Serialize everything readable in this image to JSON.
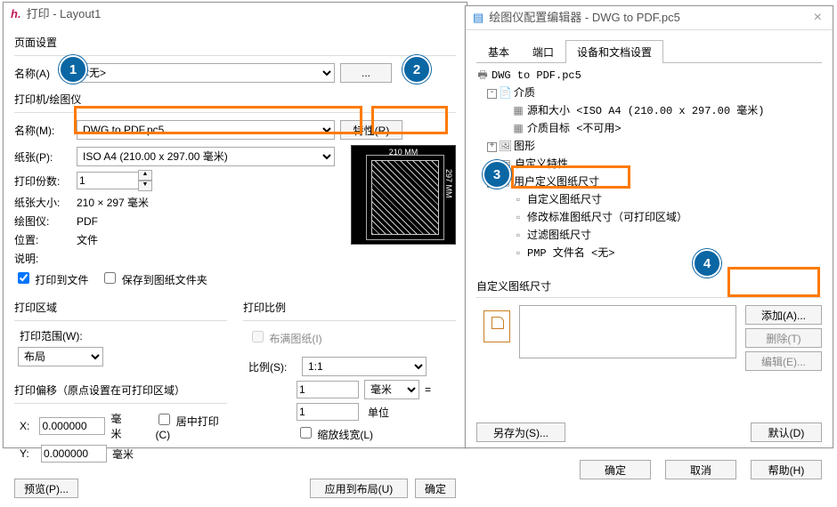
{
  "print": {
    "title_prefix": "打印",
    "title_doc": "Layout1",
    "page_setup": "页面设置",
    "name_a": "名称(A)",
    "name_a_value": "<无>",
    "name_a_btn": "...",
    "printer_group": "打印机/绘图仪",
    "name_m": "名称(M):",
    "name_m_value": "DWG to PDF.pc5",
    "props_btn": "特性(R)",
    "paper_p": "纸张(P):",
    "paper_p_value": "ISO A4 (210.00 x 297.00 毫米)",
    "copies": "打印份数:",
    "copies_value": "1",
    "paper_size": "纸张大小:",
    "paper_size_value": "210 × 297 毫米",
    "plotter": "绘图仪:",
    "plotter_value": "PDF",
    "location": "位置:",
    "location_value": "文件",
    "desc": "说明:",
    "chk_to_file": "打印到文件",
    "chk_save_folder": "保存到图纸文件夹",
    "preview_w": "210 MM",
    "preview_h": "297 MM",
    "area_group": "打印区域",
    "area_range": "打印范围(W):",
    "area_range_value": "布局",
    "scale_group": "打印比例",
    "fit_paper": "布满图纸(I)",
    "scale_s": "比例(S):",
    "scale_s_value": "1:1",
    "unit_mm": "毫米",
    "unit_units": "单位",
    "scale_v1": "1",
    "scale_v2": "1",
    "equals": "=",
    "scale_lw": "缩放线宽(L)",
    "offset_group": "打印偏移（原点设置在可打印区域）",
    "x": "X:",
    "y": "Y:",
    "xv": "0.000000",
    "yv": "0.000000",
    "mm": "毫米",
    "center": "居中打印(C)",
    "preview_btn": "预览(P)...",
    "apply_btn": "应用到布局(U)",
    "ok_btn": "确定"
  },
  "cfg": {
    "title_prefix": "绘图仪配置编辑器",
    "title_doc": "DWG to PDF.pc5",
    "tab_basic": "基本",
    "tab_port": "端口",
    "tab_device": "设备和文档设置",
    "tree": {
      "root": "DWG to PDF.pc5",
      "media": "介质",
      "media_src": "源和大小 <ISO A4 (210.00 x 297.00 毫米)",
      "media_tgt": "介质目标 <不可用>",
      "graphics": "图形",
      "custom_props": "自定义特性",
      "user_paper": "用户定义图纸尺寸",
      "custom_paper": "自定义图纸尺寸",
      "modify_std": "修改标准图纸尺寸（可打印区域）",
      "filter_paper": "过滤图纸尺寸",
      "pmp_file": "PMP 文件名 <无>"
    },
    "section": "自定义图纸尺寸",
    "add_btn": "添加(A)...",
    "del_btn": "删除(T)",
    "edit_btn": "编辑(E)...",
    "saveas_btn": "另存为(S)...",
    "default_btn": "默认(D)",
    "ok": "确定",
    "cancel": "取消",
    "help": "帮助(H)"
  },
  "badges": {
    "b1": "1",
    "b2": "2",
    "b3": "3",
    "b4": "4"
  }
}
